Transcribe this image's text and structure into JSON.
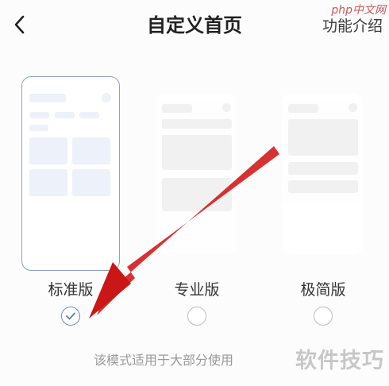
{
  "header": {
    "title": "自定义首页",
    "feature_link": "功能介绍",
    "watermark": "php中文网"
  },
  "modes": [
    {
      "label": "标准版",
      "selected": true
    },
    {
      "label": "专业版",
      "selected": false
    },
    {
      "label": "极简版",
      "selected": false
    }
  ],
  "description": "该模式适用于大部分使用",
  "watermark_bottom": "软件技巧",
  "colors": {
    "accent": "#6f8fae",
    "arrow": "#d42020"
  }
}
